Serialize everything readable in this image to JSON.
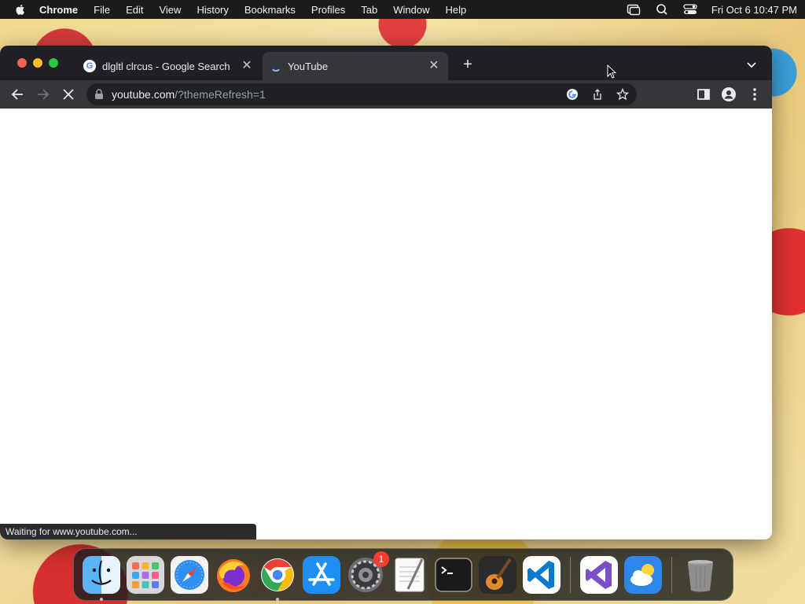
{
  "menubar": {
    "app_name": "Chrome",
    "items": [
      "File",
      "Edit",
      "View",
      "History",
      "Bookmarks",
      "Profiles",
      "Tab",
      "Window",
      "Help"
    ],
    "datetime": "Fri Oct 6  10:47 PM"
  },
  "browser": {
    "tabs": [
      {
        "title": "dlgltl clrcus - Google Search",
        "favicon": "google-g-icon",
        "active": false
      },
      {
        "title": "YouTube",
        "favicon": "loading-spinner-icon",
        "active": true
      }
    ],
    "url_host": "youtube.com",
    "url_path": "/?themeRefresh=1",
    "status_text": "Waiting for www.youtube.com..."
  },
  "dock": {
    "apps": [
      {
        "name": "Finder",
        "icon": "finder-icon",
        "running": true
      },
      {
        "name": "Launchpad",
        "icon": "launchpad-icon",
        "running": false
      },
      {
        "name": "Safari",
        "icon": "safari-icon",
        "running": false
      },
      {
        "name": "Firefox",
        "icon": "firefox-icon",
        "running": false
      },
      {
        "name": "Google Chrome",
        "icon": "chrome-icon",
        "running": true
      },
      {
        "name": "App Store",
        "icon": "app-store-icon",
        "running": false
      },
      {
        "name": "System Settings",
        "icon": "system-settings-icon",
        "running": false,
        "badge": "1"
      },
      {
        "name": "TextEdit",
        "icon": "textedit-icon",
        "running": false
      },
      {
        "name": "Terminal",
        "icon": "terminal-icon",
        "running": false
      },
      {
        "name": "GarageBand",
        "icon": "garageband-icon",
        "running": false
      },
      {
        "name": "Visual Studio Code",
        "icon": "vscode-icon",
        "running": false
      },
      {
        "name": "Visual Studio",
        "icon": "visual-studio-icon",
        "running": false
      },
      {
        "name": "Weather",
        "icon": "weather-icon",
        "running": false
      },
      {
        "name": "Trash",
        "icon": "trash-icon",
        "running": false
      }
    ]
  },
  "colors": {
    "menubar_bg": "#1b1b1d",
    "tabbar_bg": "#1f2023",
    "toolbar_bg": "#35363a",
    "omnibox_bg": "#202124",
    "close": "#ff5f57",
    "minimize": "#febc2e",
    "maximize": "#28c840"
  }
}
